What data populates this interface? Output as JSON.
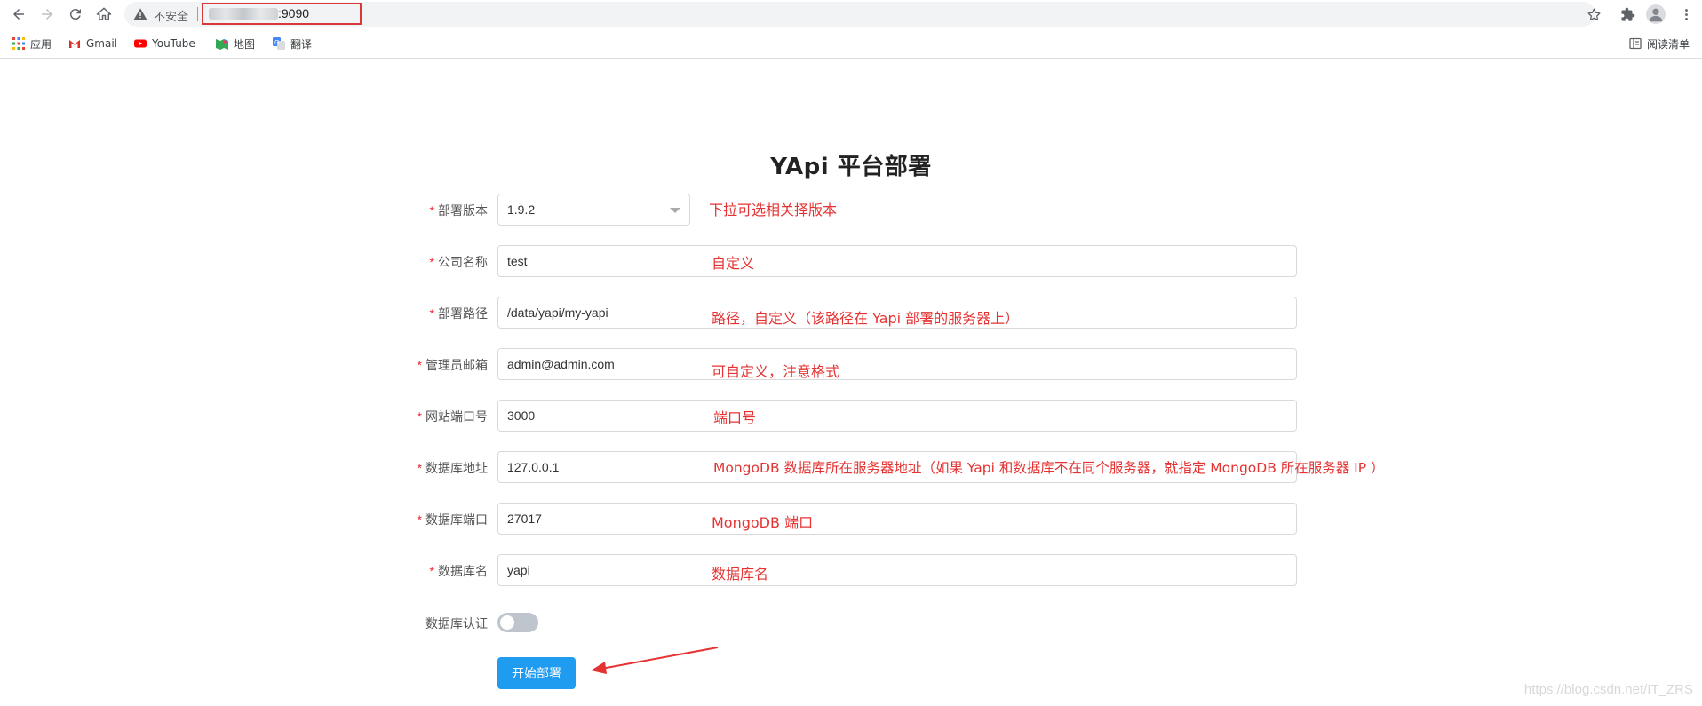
{
  "browser": {
    "security_label": "不安全",
    "url_suffix": ":9090",
    "bookmarks": [
      {
        "label": "应用",
        "icon": "apps-grid-icon"
      },
      {
        "label": "Gmail",
        "icon": "gmail-icon"
      },
      {
        "label": "YouTube",
        "icon": "youtube-icon"
      },
      {
        "label": "地图",
        "icon": "maps-icon"
      },
      {
        "label": "翻译",
        "icon": "translate-icon"
      }
    ],
    "reading_list": "阅读清单"
  },
  "page": {
    "title": "YApi 平台部署",
    "fields": [
      {
        "label": "部署版本",
        "value": "1.9.2",
        "note": "下拉可选相关择版本"
      },
      {
        "label": "公司名称",
        "value": "test",
        "note": "自定义"
      },
      {
        "label": "部署路径",
        "value": "/data/yapi/my-yapi",
        "note": "路径，自定义（该路径在 Yapi 部署的服务器上）"
      },
      {
        "label": "管理员邮箱",
        "value": "admin@admin.com",
        "note": "可自定义，注意格式"
      },
      {
        "label": "网站端口号",
        "value": "3000",
        "note": "端口号"
      },
      {
        "label": "数据库地址",
        "value": "127.0.0.1",
        "note": "MongoDB 数据库所在服务器地址（如果 Yapi 和数据库不在同个服务器，就指定 MongoDB 所在服务器 IP ）"
      },
      {
        "label": "数据库端口",
        "value": "27017",
        "note": "MongoDB 端口"
      },
      {
        "label": "数据库名",
        "value": "yapi",
        "note": "数据库名"
      }
    ],
    "auth_label": "数据库认证",
    "auth_enabled": false,
    "submit_label": "开始部署",
    "required_mark": "*"
  },
  "watermark": "https://blog.csdn.net/IT_ZRS",
  "colors": {
    "accent": "#1f9bf0",
    "annotation": "#e53333",
    "required": "#f5222d",
    "highlight_box": "#d9383b"
  }
}
